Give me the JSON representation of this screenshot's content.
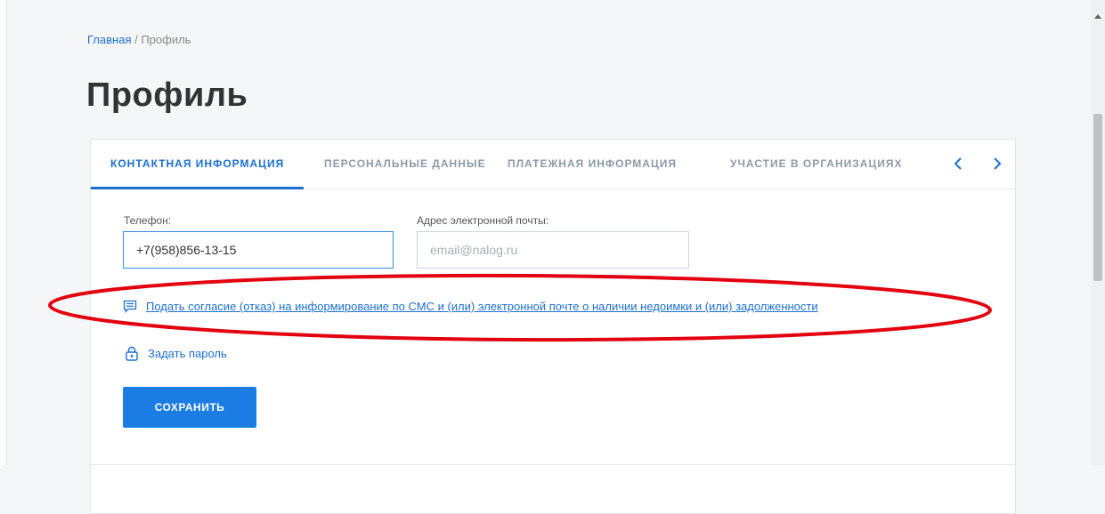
{
  "breadcrumb": {
    "home": "Главная",
    "separator": " / ",
    "current": "Профиль"
  },
  "page": {
    "title": "Профиль"
  },
  "tabs": [
    {
      "label": "КОНТАКТНАЯ ИНФОРМАЦИЯ",
      "active": true
    },
    {
      "label": "ПЕРСОНАЛЬНЫЕ ДАННЫЕ",
      "active": false
    },
    {
      "label": "ПЛАТЕЖНАЯ ИНФОРМАЦИЯ",
      "active": false
    },
    {
      "label": "УЧАСТИЕ В ОРГАНИЗАЦИЯХ",
      "active": false
    }
  ],
  "form": {
    "phone_label": "Телефон:",
    "phone_value": "+7(958)856-13-15",
    "email_label": "Адрес электронной почты:",
    "email_placeholder": "email@nalog.ru",
    "consent_link": "Подать согласие (отказ) на информирование по СМС и (или) электронной почте о наличии недоимки и (или) задолженности",
    "password_link": "Задать пароль",
    "save_label": "СОХРАНИТЬ"
  },
  "icons": {
    "consent": "message-icon",
    "password": "lock-icon",
    "prev": "chevron-left-icon",
    "next": "chevron-right-icon"
  },
  "colors": {
    "accent": "#1b6fd0",
    "button": "#1b7de3",
    "annotation": "#e3000f"
  }
}
